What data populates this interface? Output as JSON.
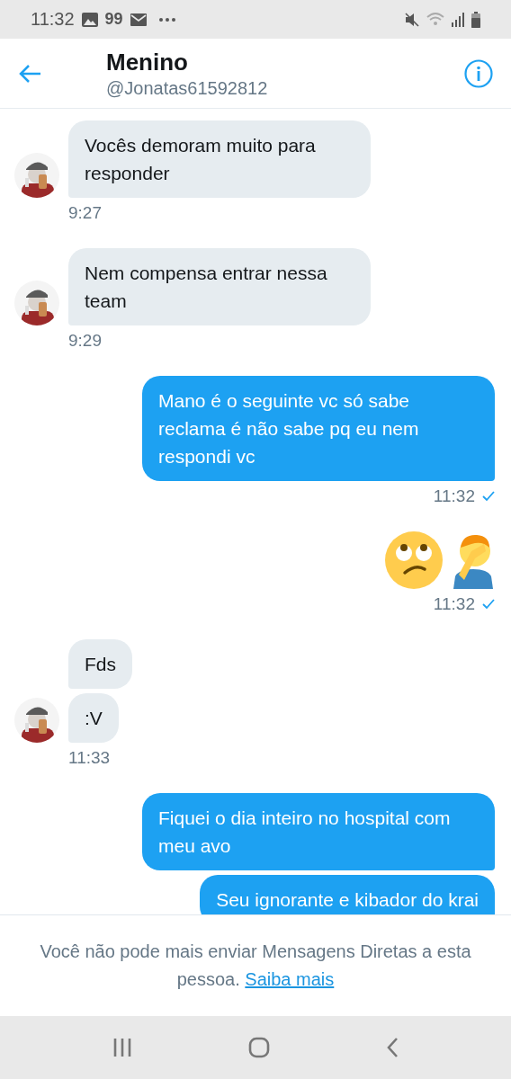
{
  "status_bar": {
    "time": "11:32",
    "notification_count": "99"
  },
  "header": {
    "name": "Menino",
    "handle": "@Jonatas61592812"
  },
  "messages": [
    {
      "kind": "received",
      "bubbles": [
        "Vocês demoram muito para responder"
      ],
      "time": "9:27"
    },
    {
      "kind": "received",
      "bubbles": [
        "Nem compensa entrar nessa team"
      ],
      "time": "9:29"
    },
    {
      "kind": "sent",
      "bubbles": [
        "Mano é o seguinte vc só sabe reclama é não sabe pq eu nem respondi vc"
      ],
      "time": "11:32",
      "read": true
    },
    {
      "kind": "emoji",
      "time": "11:32",
      "read": true
    },
    {
      "kind": "received",
      "bubbles": [
        "Fds",
        ":V"
      ],
      "time": "11:33"
    },
    {
      "kind": "sent",
      "bubbles": [
        "Fiquei o dia inteiro no hospital com meu avo",
        "Seu ignorante e kibador do krai"
      ]
    }
  ],
  "footer": {
    "notice": "Você não pode mais enviar Mensagens Diretas a esta pessoa.",
    "link": "Saiba mais"
  }
}
